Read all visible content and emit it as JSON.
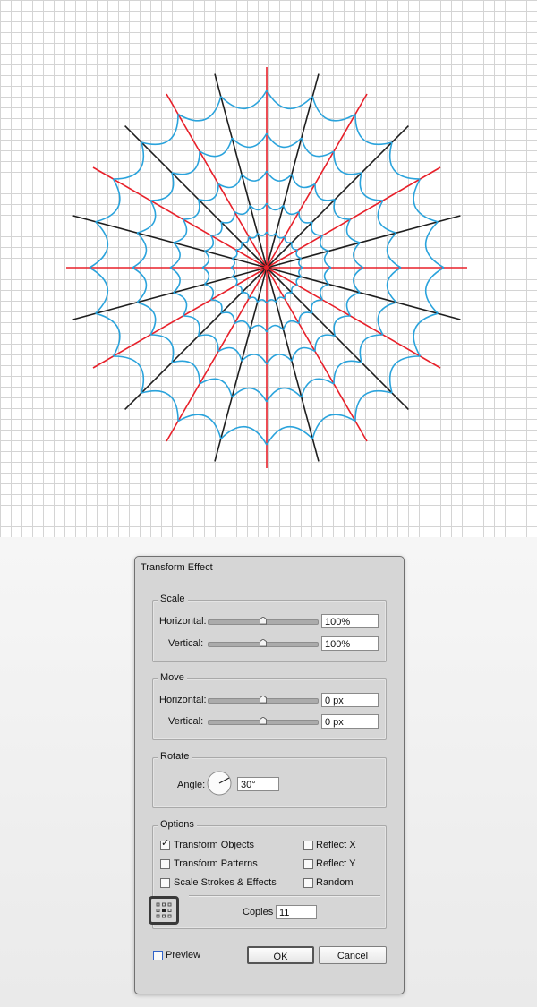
{
  "dialog": {
    "title": "Transform Effect",
    "scale": {
      "legend": "Scale",
      "horizontal_label": "Horizontal:",
      "horizontal_value": "100%",
      "vertical_label": "Vertical:",
      "vertical_value": "100%"
    },
    "move": {
      "legend": "Move",
      "horizontal_label": "Horizontal:",
      "horizontal_value": "0 px",
      "vertical_label": "Vertical:",
      "vertical_value": "0 px"
    },
    "rotate": {
      "legend": "Rotate",
      "angle_label": "Angle:",
      "angle_value": "30°"
    },
    "options": {
      "legend": "Options",
      "transform_objects": "Transform Objects",
      "transform_objects_checked": true,
      "transform_patterns": "Transform Patterns",
      "scale_strokes": "Scale Strokes & Effects",
      "reflect_x": "Reflect X",
      "reflect_y": "Reflect Y",
      "random": "Random",
      "copies_label": "Copies",
      "copies_value": "11"
    },
    "preview_label": "Preview",
    "ok_label": "OK",
    "cancel_label": "Cancel"
  },
  "colors": {
    "red_lines": "#e8202a",
    "black_lines": "#1e1e1e",
    "web_threads": "#2aa3dc"
  },
  "icons": {
    "reference_point": "reference-point-grid-icon",
    "angle_dial": "angle-dial-icon"
  }
}
